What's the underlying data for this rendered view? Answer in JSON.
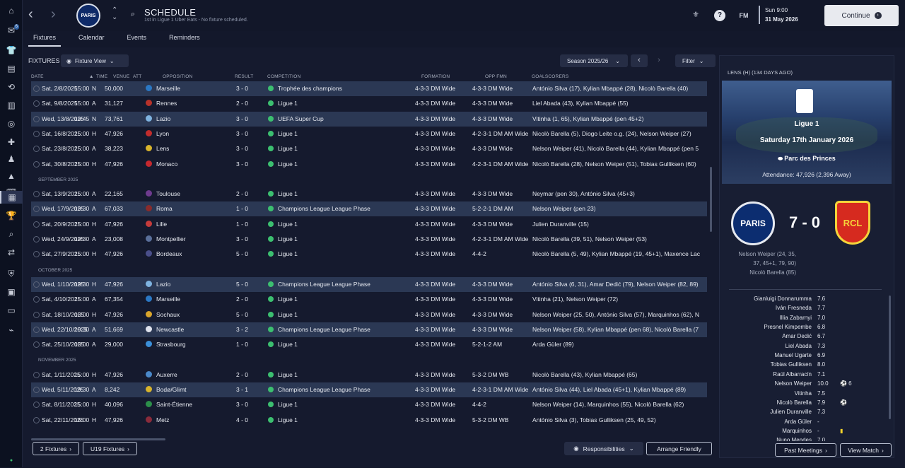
{
  "sidebar": {
    "badge": "6"
  },
  "header": {
    "club_crest_text": "PARIS",
    "title": "SCHEDULE",
    "subtitle": "1st in Ligue 1 Uber Eats - No fixture scheduled.",
    "fm_label": "FM",
    "date_day": "Sun 9:00",
    "date_full": "31 May 2026",
    "continue_label": "Continue"
  },
  "tabs": [
    "Fixtures",
    "Calendar",
    "Events",
    "Reminders"
  ],
  "fixtures": {
    "heading": "FIXTURES",
    "view_button": "Fixture View",
    "season": "Season 2025/26",
    "filter": "Filter",
    "columns": {
      "date": "DATE",
      "time": "TIME",
      "venue": "VENUE",
      "att": "ATT",
      "opposition": "OPPOSITION",
      "result": "RESULT",
      "competition": "COMPETITION",
      "formation": "FORMATION",
      "opp_fmn": "OPP FMN",
      "goalscorers": "GOALSCORERS"
    },
    "months": [
      "SEPTEMBER 2025",
      "OCTOBER 2025",
      "NOVEMBER 2025"
    ],
    "rows": [
      {
        "date": "Sat, 2/8/2025",
        "time": "15:00",
        "venue": "N",
        "att": "50,000",
        "opp": "Marseille",
        "result": "3 - 0",
        "comp": "Trophée des champions",
        "fmn": "4-3-3 DM Wide",
        "opp_fmn": "4-3-3 DM Wide",
        "scorers": "António Silva (17), Kylian Mbappé (28), Nicolò Barella (40)"
      },
      {
        "date": "Sat, 9/8/2025",
        "time": "15:00",
        "venue": "A",
        "att": "31,127",
        "opp": "Rennes",
        "result": "2 - 0",
        "comp": "Ligue 1",
        "fmn": "4-3-3 DM Wide",
        "opp_fmn": "4-3-3 DM Wide",
        "scorers": "Liel Abada (43), Kylian Mbappé (55)"
      },
      {
        "date": "Wed, 13/8/2025",
        "time": "19:45",
        "venue": "N",
        "att": "73,761",
        "opp": "Lazio",
        "result": "3 - 0",
        "comp": "UEFA Super Cup",
        "fmn": "4-3-3 DM Wide",
        "opp_fmn": "4-3-3 DM Wide",
        "scorers": "Vitinha (1, 65), Kylian Mbappé (pen 45+2)"
      },
      {
        "date": "Sat, 16/8/2025",
        "time": "15:00",
        "venue": "H",
        "att": "47,926",
        "opp": "Lyon",
        "result": "3 - 0",
        "comp": "Ligue 1",
        "fmn": "4-3-3 DM Wide",
        "opp_fmn": "4-2-3-1 DM AM Wide",
        "scorers": "Nicolò Barella (5), Diogo Leite o.g. (24), Nelson Weiper (27)"
      },
      {
        "date": "Sat, 23/8/2025",
        "time": "15:00",
        "venue": "A",
        "att": "38,223",
        "opp": "Lens",
        "result": "3 - 0",
        "comp": "Ligue 1",
        "fmn": "4-3-3 DM Wide",
        "opp_fmn": "4-3-3 DM Wide",
        "scorers": "Nelson Weiper (41), Nicolò Barella (44), Kylian Mbappé (pen 5"
      },
      {
        "date": "Sat, 30/8/2025",
        "time": "15:00",
        "venue": "H",
        "att": "47,926",
        "opp": "Monaco",
        "result": "3 - 0",
        "comp": "Ligue 1",
        "fmn": "4-3-3 DM Wide",
        "opp_fmn": "4-2-3-1 DM AM Wide",
        "scorers": "Nicolò Barella (28), Nelson Weiper (51), Tobias Gulliksen (60)"
      },
      {
        "date": "Sat, 13/9/2025",
        "time": "15:00",
        "venue": "A",
        "att": "22,165",
        "opp": "Toulouse",
        "result": "2 - 0",
        "comp": "Ligue 1",
        "fmn": "4-3-3 DM Wide",
        "opp_fmn": "4-3-3 DM Wide",
        "scorers": "Neymar (pen 30), António Silva (45+3)"
      },
      {
        "date": "Wed, 17/9/2025",
        "time": "19:30",
        "venue": "A",
        "att": "67,033",
        "opp": "Roma",
        "result": "1 - 0",
        "comp": "Champions League League Phase",
        "fmn": "4-3-3 DM Wide",
        "opp_fmn": "5-2-2-1 DM AM",
        "scorers": "Nelson Weiper (pen 23)"
      },
      {
        "date": "Sat, 20/9/2025",
        "time": "15:00",
        "venue": "H",
        "att": "47,926",
        "opp": "Lille",
        "result": "1 - 0",
        "comp": "Ligue 1",
        "fmn": "4-3-3 DM Wide",
        "opp_fmn": "4-3-3 DM Wide",
        "scorers": "Julien Duranville (15)"
      },
      {
        "date": "Wed, 24/9/2025",
        "time": "19:30",
        "venue": "A",
        "att": "23,008",
        "opp": "Montpellier",
        "result": "3 - 0",
        "comp": "Ligue 1",
        "fmn": "4-3-3 DM Wide",
        "opp_fmn": "4-2-3-1 DM AM Wide",
        "scorers": "Nicolò Barella (39, 51), Nelson Weiper (53)"
      },
      {
        "date": "Sat, 27/9/2025",
        "time": "15:00",
        "venue": "H",
        "att": "47,926",
        "opp": "Bordeaux",
        "result": "5 - 0",
        "comp": "Ligue 1",
        "fmn": "4-3-3 DM Wide",
        "opp_fmn": "4-4-2",
        "scorers": "Nicolò Barella (5, 49), Kylian Mbappé (19, 45+1), Maxence Lac"
      },
      {
        "date": "Wed, 1/10/2025",
        "time": "19:30",
        "venue": "H",
        "att": "47,926",
        "opp": "Lazio",
        "result": "5 - 0",
        "comp": "Champions League League Phase",
        "fmn": "4-3-3 DM Wide",
        "opp_fmn": "4-3-3 DM Wide",
        "scorers": "António Silva (6, 31), Amar Dedić (79), Nelson Weiper (82, 89)"
      },
      {
        "date": "Sat, 4/10/2025",
        "time": "15:00",
        "venue": "A",
        "att": "67,354",
        "opp": "Marseille",
        "result": "2 - 0",
        "comp": "Ligue 1",
        "fmn": "4-3-3 DM Wide",
        "opp_fmn": "4-3-3 DM Wide",
        "scorers": "Vitinha (21), Nelson Weiper (72)"
      },
      {
        "date": "Sat, 18/10/2025",
        "time": "15:00",
        "venue": "H",
        "att": "47,926",
        "opp": "Sochaux",
        "result": "5 - 0",
        "comp": "Ligue 1",
        "fmn": "4-3-3 DM Wide",
        "opp_fmn": "4-3-3 DM Wide",
        "scorers": "Nelson Weiper (25, 50), António Silva (57), Marquinhos (62), N"
      },
      {
        "date": "Wed, 22/10/2025",
        "time": "19:30",
        "venue": "A",
        "att": "51,669",
        "opp": "Newcastle",
        "result": "3 - 2",
        "comp": "Champions League League Phase",
        "fmn": "4-3-3 DM Wide",
        "opp_fmn": "4-3-3 DM Wide",
        "scorers": "Nelson Weiper (58), Kylian Mbappé (pen 68), Nicolò Barella (7"
      },
      {
        "date": "Sat, 25/10/2025",
        "time": "15:00",
        "venue": "A",
        "att": "29,000",
        "opp": "Strasbourg",
        "result": "1 - 0",
        "comp": "Ligue 1",
        "fmn": "4-3-3 DM Wide",
        "opp_fmn": "5-2-1-2 AM",
        "scorers": "Arda Güler (89)"
      },
      {
        "date": "Sat, 1/11/2025",
        "time": "15:00",
        "venue": "H",
        "att": "47,926",
        "opp": "Auxerre",
        "result": "2 - 0",
        "comp": "Ligue 1",
        "fmn": "4-3-3 DM Wide",
        "opp_fmn": "5-3-2 DM WB",
        "scorers": "Nicolò Barella (43), Kylian Mbappé (65)"
      },
      {
        "date": "Wed, 5/11/2025",
        "time": "19:30",
        "venue": "A",
        "att": "8,242",
        "opp": "Bodø/Glimt",
        "result": "3 - 1",
        "comp": "Champions League League Phase",
        "fmn": "4-3-3 DM Wide",
        "opp_fmn": "4-2-3-1 DM AM Wide",
        "scorers": "António Silva (44), Liel Abada (45+1), Kylian Mbappé (89)"
      },
      {
        "date": "Sat, 8/11/2025",
        "time": "15:00",
        "venue": "H",
        "att": "40,096",
        "opp": "Saint-Étienne",
        "result": "3 - 0",
        "comp": "Ligue 1",
        "fmn": "4-3-3 DM Wide",
        "opp_fmn": "4-4-2",
        "scorers": "Nelson Weiper (14), Marquinhos (55), Nicolò Barella (62)"
      },
      {
        "date": "Sat, 22/11/2025",
        "time": "15:00",
        "venue": "H",
        "att": "47,926",
        "opp": "Metz",
        "result": "4 - 0",
        "comp": "Ligue 1",
        "fmn": "4-3-3 DM Wide",
        "opp_fmn": "5-3-2 DM WB",
        "scorers": "António Silva (3), Tobias Gulliksen (25, 49, 52)"
      }
    ],
    "team_colors": [
      "#2b78c4",
      "#b8322a",
      "#7fb3e0",
      "#c22c2c",
      "#d8b42c",
      "#c5282e",
      "#6e3b8e",
      "#8a2b2b",
      "#c53b3b",
      "#5a6f9a",
      "#4a4f8a",
      "#7fb3e0",
      "#2b78c4",
      "#d9a52c",
      "#dfe3ee",
      "#3b8fd9",
      "#4a88c9",
      "#d8b42c",
      "#2c8f4a",
      "#8a2b3b"
    ]
  },
  "bottom": {
    "fixtures_btn": "2 Fixtures",
    "u19_btn": "U19 Fixtures",
    "responsibilities": "Responsibilities",
    "arrange": "Arrange Friendly",
    "past_meetings": "Past Meetings",
    "view_match": "View Match"
  },
  "match": {
    "header": "LENS (H) (134 DAYS AGO)",
    "competition": "Ligue 1",
    "date": "Saturday 17th January 2026",
    "venue": "Parc des Princes",
    "attendance": "Attendance: 47,926 (2,396 Away)",
    "score": "7 - 0",
    "home_crest": "PARIS",
    "away_crest": "RCL",
    "scorers": [
      "Nelson Weiper (24, 35,",
      "37, 45+1, 79, 90)",
      "Nicolò Barella (85)"
    ],
    "players": [
      {
        "name": "Gianluigi Donnarumma",
        "rating": "7.6",
        "extra": ""
      },
      {
        "name": "Iván Fresneda",
        "rating": "7.7",
        "extra": ""
      },
      {
        "name": "Illia Zabarnyi",
        "rating": "7.0",
        "extra": ""
      },
      {
        "name": "Presnel Kimpembe",
        "rating": "6.8",
        "extra": ""
      },
      {
        "name": "Amar Dedić",
        "rating": "6.7",
        "extra": ""
      },
      {
        "name": "Liel Abada",
        "rating": "7.3",
        "extra": ""
      },
      {
        "name": "Manuel Ugarte",
        "rating": "6.9",
        "extra": ""
      },
      {
        "name": "Tobias Gulliksen",
        "rating": "8.0",
        "extra": ""
      },
      {
        "name": "Raúl Albarracín",
        "rating": "7.1",
        "extra": ""
      },
      {
        "name": "Nelson Weiper",
        "rating": "10.0",
        "extra": "⚽ 6"
      },
      {
        "name": "Vitinha",
        "rating": "7.5",
        "extra": ""
      },
      {
        "name": "Nicolò Barella",
        "rating": "7.9",
        "extra": "⚽"
      },
      {
        "name": "Julien Duranville",
        "rating": "7.3",
        "extra": ""
      },
      {
        "name": "Arda Güler",
        "rating": "-",
        "extra": ""
      },
      {
        "name": "Marquinhos",
        "rating": "-",
        "extra": "▮"
      },
      {
        "name": "Nuno Mendes",
        "rating": "7.0",
        "extra": ""
      }
    ]
  }
}
